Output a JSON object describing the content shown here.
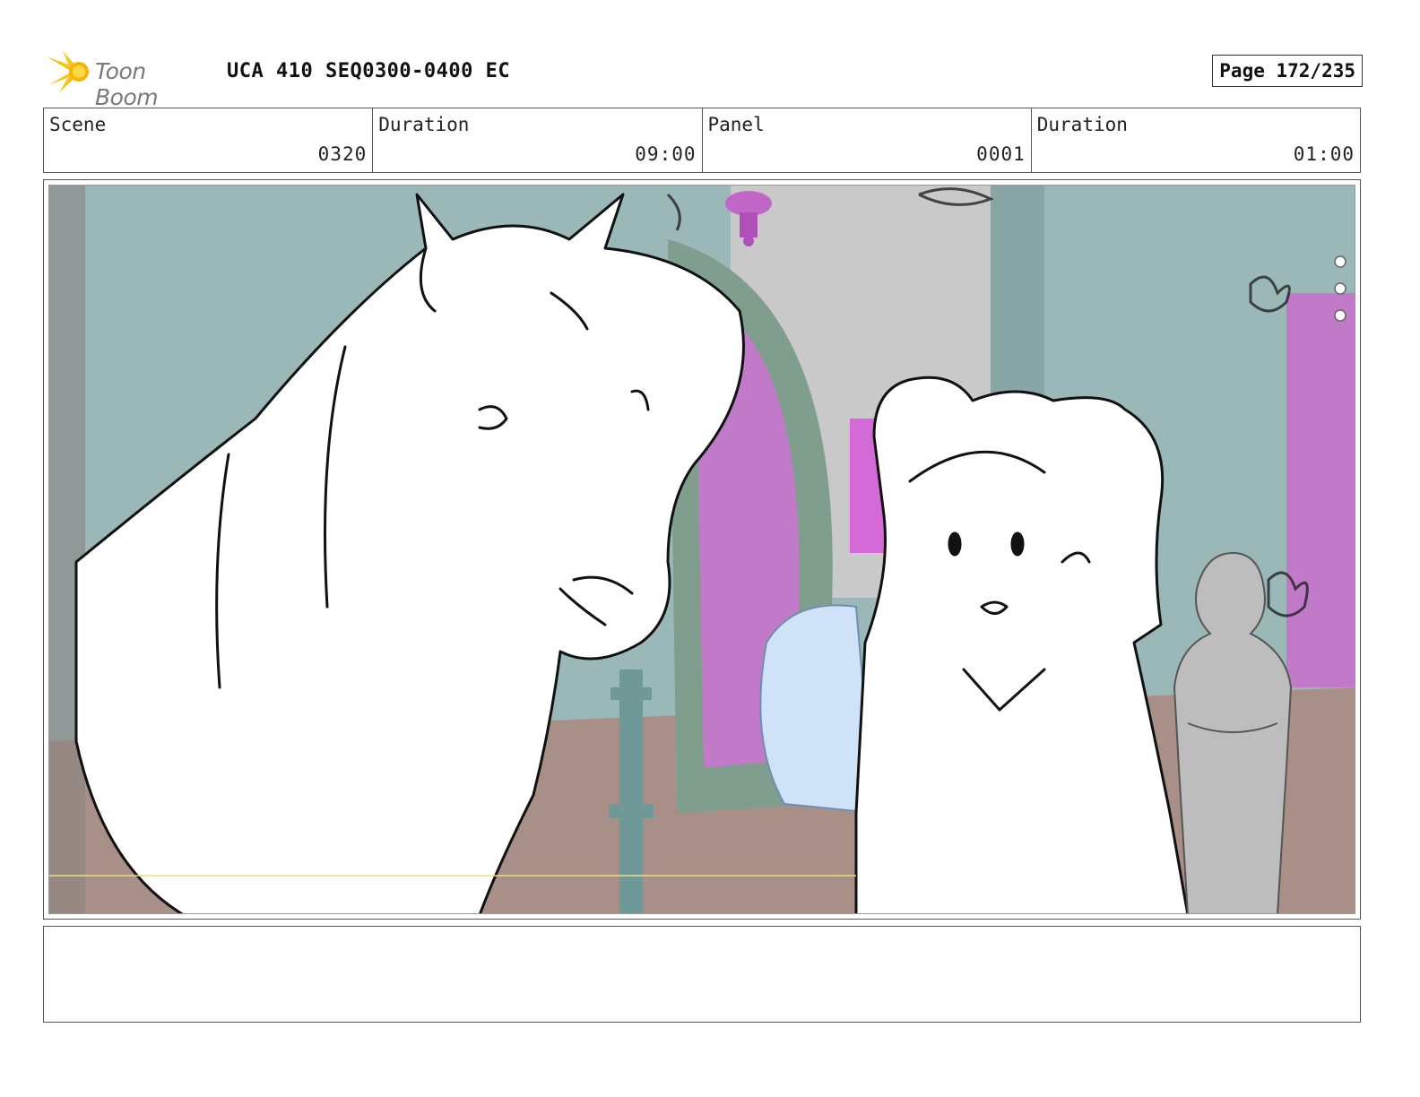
{
  "header": {
    "logo_text": "Toon Boom",
    "doc_title": "UCA 410 SEQ0300-0400 EC",
    "page_label": "Page 172/235"
  },
  "info": [
    {
      "label": "Scene",
      "value": "0320"
    },
    {
      "label": "Duration",
      "value": "09:00"
    },
    {
      "label": "Panel",
      "value": "0001"
    },
    {
      "label": "Duration",
      "value": "01:00"
    }
  ],
  "notes": {
    "text": ""
  },
  "colors": {
    "logo_yellow": "#f5c518",
    "teal_wall": "#9ab8b8",
    "magenta_window": "#c07ac8",
    "floor_brown": "#a89088",
    "cloth_blue": "#cfe2f7",
    "sketch_line": "#111111"
  }
}
